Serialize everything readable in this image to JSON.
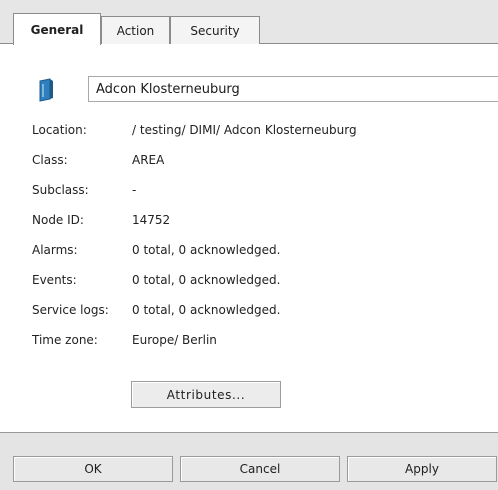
{
  "tabs": {
    "general": "General",
    "action": "Action",
    "security": "Security"
  },
  "object": {
    "icon": "node-object-icon",
    "name": "Adcon Klosterneuburg"
  },
  "properties": [
    {
      "label": "Location:",
      "value": "/ testing/ DIMI/ Adcon Klosterneuburg"
    },
    {
      "label": "Class:",
      "value": "AREA"
    },
    {
      "label": "Subclass:",
      "value": "-"
    },
    {
      "label": "Node ID:",
      "value": "14752"
    },
    {
      "label": "Alarms:",
      "value": "0 total, 0 acknowledged."
    },
    {
      "label": "Events:",
      "value": "0 total, 0 acknowledged."
    },
    {
      "label": "Service logs:",
      "value": "0 total, 0 acknowledged."
    },
    {
      "label": "Time zone:",
      "value": "Europe/ Berlin"
    }
  ],
  "attributes_button": "Attributes...",
  "footer": {
    "ok": "OK",
    "cancel": "Cancel",
    "apply": "Apply"
  },
  "colors": {
    "icon_blue": "#2f7fbf",
    "icon_dark": "#1d5a8a",
    "tab_strip": "#e6e6e6",
    "footer": "#e4e4e4"
  }
}
